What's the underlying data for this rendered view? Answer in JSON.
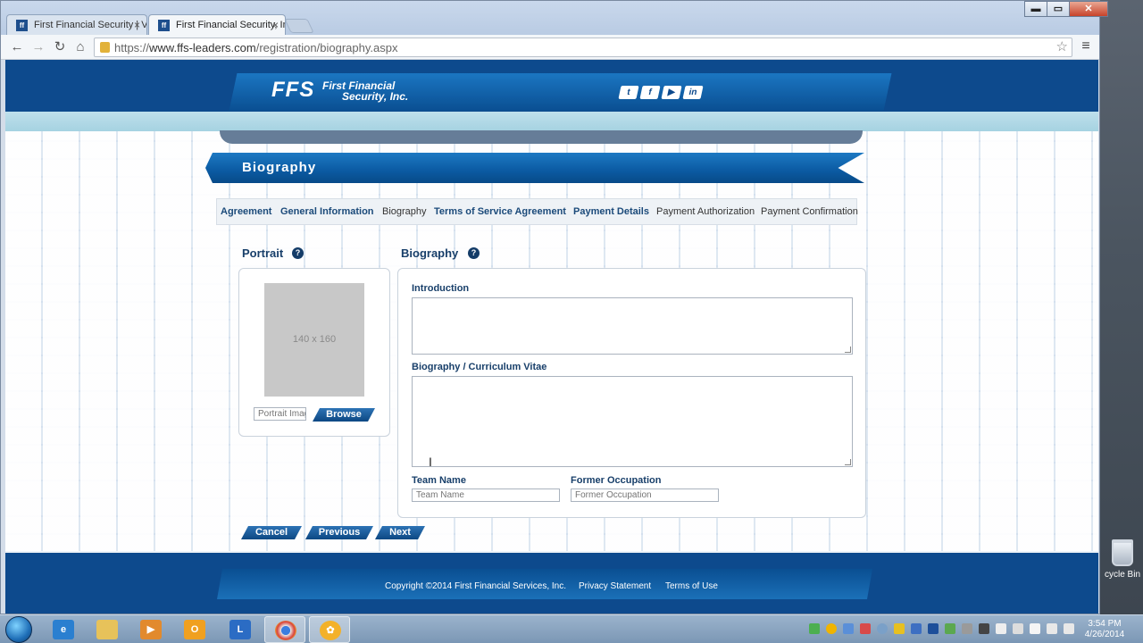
{
  "browser": {
    "tabs": [
      {
        "title": "First Financial Security | V",
        "active": false
      },
      {
        "title": "First Financial Security, Inc",
        "active": true
      }
    ],
    "url_prefix": "https://",
    "url_host": "www.ffs-leaders.com",
    "url_path": "/registration/biography.aspx",
    "window_controls": {
      "minimize": "▬",
      "maximize": "▭",
      "close": "✕"
    }
  },
  "header": {
    "logo": "FFS",
    "company_line1": "First Financial",
    "company_line2": "Security, Inc.",
    "social": [
      "t",
      "f",
      "▶",
      "in"
    ]
  },
  "page": {
    "title": "Biography",
    "steps": [
      {
        "label": "Agreement",
        "done": true
      },
      {
        "label": "General Information",
        "done": true
      },
      {
        "label": "Biography",
        "done": false
      },
      {
        "label": "Terms of Service Agreement",
        "done": true
      },
      {
        "label": "Payment Details",
        "done": true
      },
      {
        "label": "Payment Authorization",
        "done": false
      },
      {
        "label": "Payment Confirmation",
        "done": false
      }
    ]
  },
  "portrait": {
    "title": "Portrait",
    "help": "?",
    "placeholder_box": "140 x 160",
    "input_placeholder": "Portrait Image",
    "browse": "Browse"
  },
  "biography": {
    "title": "Biography",
    "help": "?",
    "introduction_label": "Introduction",
    "cv_label": "Biography / Curriculum Vitae",
    "team_label": "Team Name",
    "team_placeholder": "Team Name",
    "occupation_label": "Former Occupation",
    "occupation_placeholder": "Former Occupation"
  },
  "actions": {
    "cancel": "Cancel",
    "previous": "Previous",
    "next": "Next"
  },
  "footer": {
    "copyright": "Copyright ©2014 First Financial Services, Inc.",
    "privacy": "Privacy Statement",
    "terms": "Terms of Use"
  },
  "desktop": {
    "recycle_bin": "cycle Bin"
  },
  "taskbar": {
    "time": "3:54 PM",
    "date": "4/26/2014"
  },
  "colors": {
    "brand_blue": "#0d4a8d",
    "step_done": "#1b4a7a"
  }
}
